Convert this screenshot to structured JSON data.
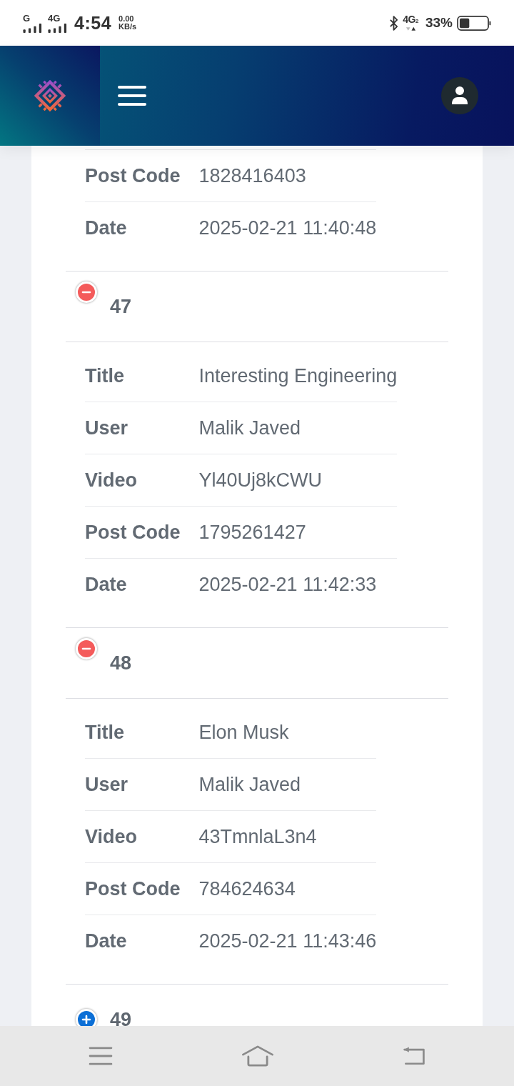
{
  "status_bar": {
    "sim_1_label": "G",
    "sim_2_label": "4G",
    "time": "4:54",
    "speed": "0.00",
    "speed_unit": "KB/s",
    "network": "4G$_{2}$",
    "battery": "33%"
  },
  "records": [
    {
      "details": [
        {
          "label": "Post Code",
          "value": "1828416403"
        },
        {
          "label": "Date",
          "value": "2025-02-21 11:40:48"
        }
      ]
    },
    {
      "number": "47",
      "expanded": true,
      "details": [
        {
          "label": "Title",
          "value": "Interesting Engineering"
        },
        {
          "label": "User",
          "value": "Malik Javed"
        },
        {
          "label": "Video",
          "value": "Yl40Uj8kCWU"
        },
        {
          "label": "Post Code",
          "value": "1795261427"
        },
        {
          "label": "Date",
          "value": "2025-02-21 11:42:33"
        }
      ]
    },
    {
      "number": "48",
      "expanded": true,
      "details": [
        {
          "label": "Title",
          "value": "Elon Musk"
        },
        {
          "label": "User",
          "value": "Malik Javed"
        },
        {
          "label": "Video",
          "value": "43TmnlaL3n4"
        },
        {
          "label": "Post Code",
          "value": "784624634"
        },
        {
          "label": "Date",
          "value": "2025-02-21 11:43:46"
        }
      ]
    },
    {
      "number": "49",
      "expanded": false
    }
  ]
}
